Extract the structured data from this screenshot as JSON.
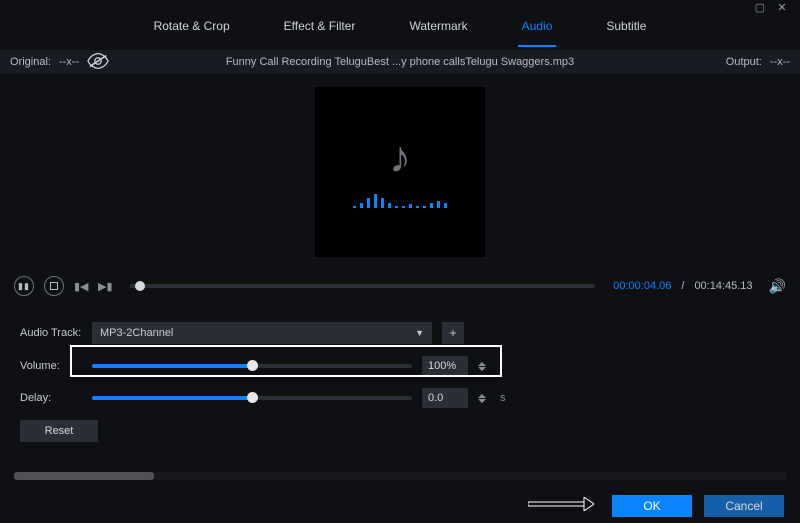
{
  "window": {
    "maximize": "▢",
    "close": "✕"
  },
  "tabs": {
    "rotate": "Rotate & Crop",
    "effect": "Effect & Filter",
    "watermark": "Watermark",
    "audio": "Audio",
    "subtitle": "Subtitle"
  },
  "subbar": {
    "original_label": "Original:",
    "original_value": "--x--",
    "filename": "Funny Call Recording TeluguBest ...y phone callsTelugu Swaggers.mp3",
    "output_label": "Output:",
    "output_value": "--x--"
  },
  "playback": {
    "current": "00:00:04.06",
    "sep": "/",
    "total": "00:14:45.13",
    "progress_percent": 1
  },
  "eq_heights": [
    2,
    5,
    10,
    14,
    10,
    5,
    2,
    2,
    4,
    2,
    2,
    5,
    7,
    5
  ],
  "audio": {
    "track_label": "Audio Track:",
    "track_value": "MP3-2Channel",
    "volume_label": "Volume:",
    "volume_value": "100%",
    "volume_percent": 50,
    "delay_label": "Delay:",
    "delay_value": "0.0",
    "delay_unit": "s",
    "delay_percent": 50,
    "reset": "Reset"
  },
  "footer": {
    "ok": "OK",
    "cancel": "Cancel"
  }
}
